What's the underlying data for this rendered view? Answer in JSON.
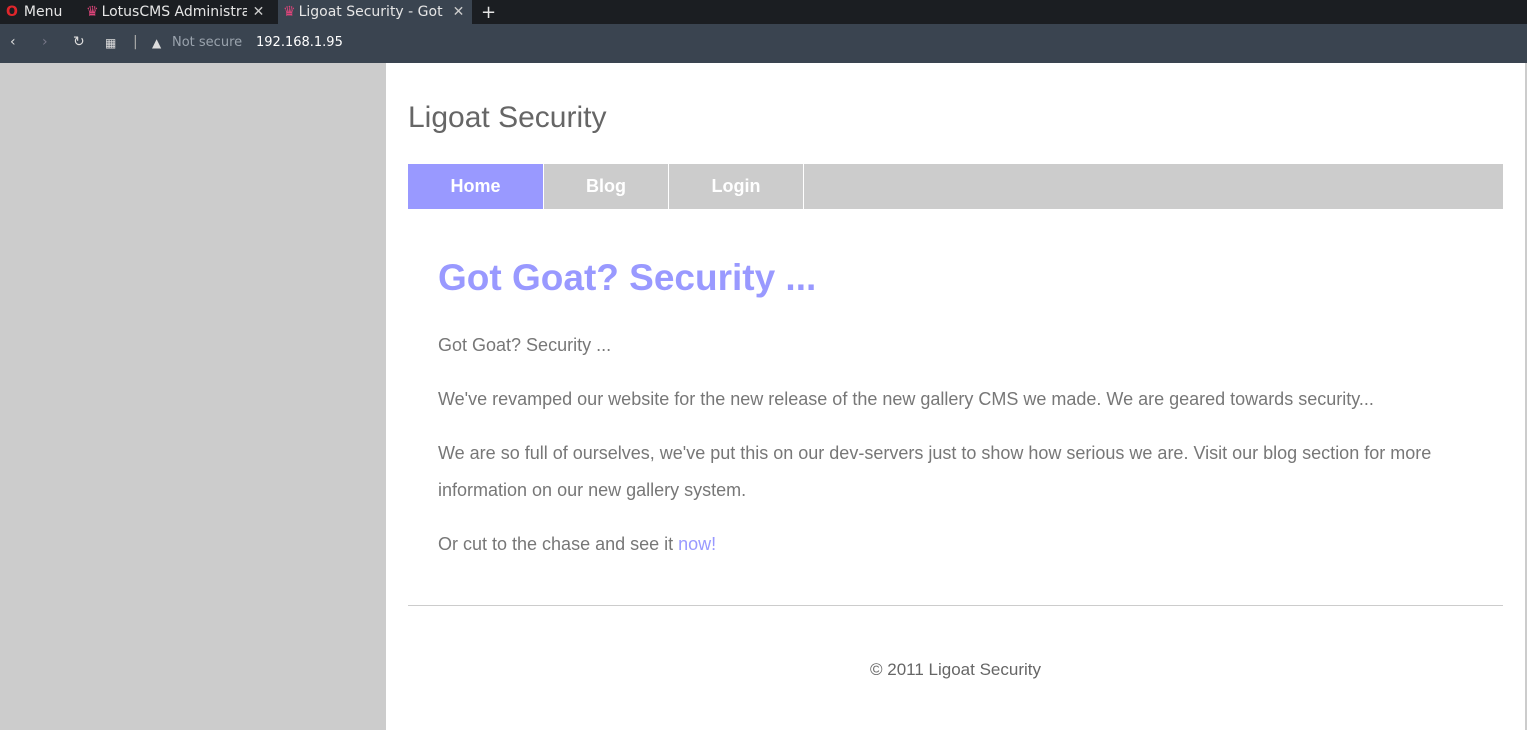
{
  "browser": {
    "menu_label": "Menu",
    "tabs": [
      {
        "title": "LotusCMS Administra"
      },
      {
        "title": "Ligoat Security - Got G"
      }
    ],
    "new_tab": "+",
    "security": "Not secure",
    "url": "192.168.1.95"
  },
  "site": {
    "title": "Ligoat Security",
    "nav": [
      {
        "label": "Home"
      },
      {
        "label": "Blog"
      },
      {
        "label": "Login"
      }
    ],
    "heading": "Got Goat? Security ...",
    "paragraphs": [
      "Got Goat? Security ...",
      "We've revamped our website for the new release of the new gallery CMS we made. We are geared towards security...",
      "We are so full of ourselves, we've put this on our dev-servers just to show how serious we are. Visit our blog section for more information on our new gallery system."
    ],
    "cta_text": "Or cut to the chase and see it ",
    "cta_link": "now!",
    "footer": "© 2011 Ligoat Security"
  },
  "colors": {
    "accent": "#9999ff",
    "nav_bg": "#cccccc",
    "text": "#777777"
  }
}
